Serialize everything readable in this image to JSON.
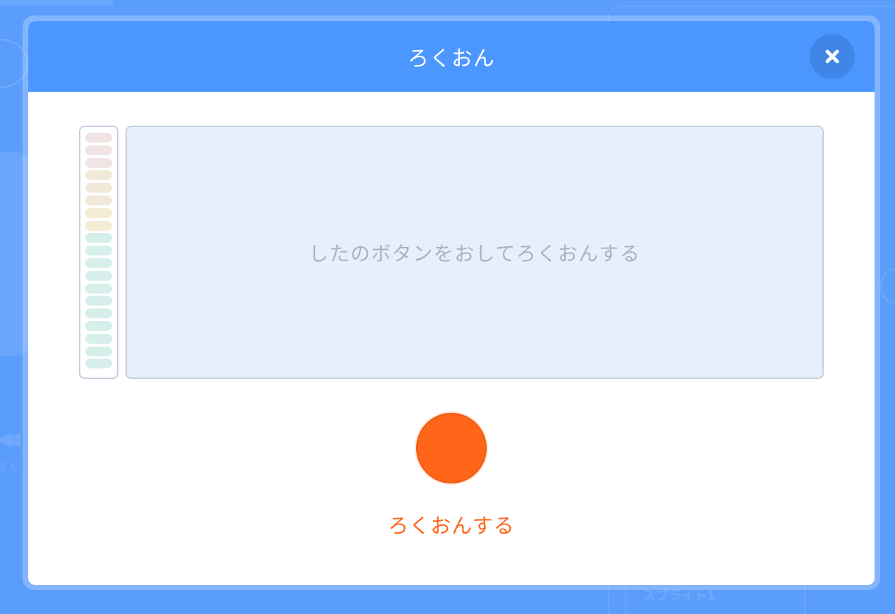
{
  "background": {
    "left_label": "そく",
    "sprite_name": "スプライト1"
  },
  "modal": {
    "title": "ろくおん",
    "close_icon": "close-x-icon",
    "waveform": {
      "instruction": "したのボタンをおしてろくおんする"
    },
    "level_meter": {
      "bar_count": 19,
      "colors": [
        "#f0e4e4",
        "#f0e4e4",
        "#f0e4e4",
        "#f2ead8",
        "#f2ead8",
        "#f2ead8",
        "#f5ecd6",
        "#f5ecd6",
        "#d6efea",
        "#d6efea",
        "#d6efea",
        "#d6efea",
        "#d6efea",
        "#d6efea",
        "#d6efea",
        "#d6efea",
        "#d6efea",
        "#d6efea",
        "#d6efea"
      ]
    },
    "record": {
      "label": "ろくおんする",
      "color": "#ff661a"
    }
  },
  "colors": {
    "header": "#4c97ff",
    "backdrop": "#5b9dfb",
    "accent": "#ff661a"
  }
}
